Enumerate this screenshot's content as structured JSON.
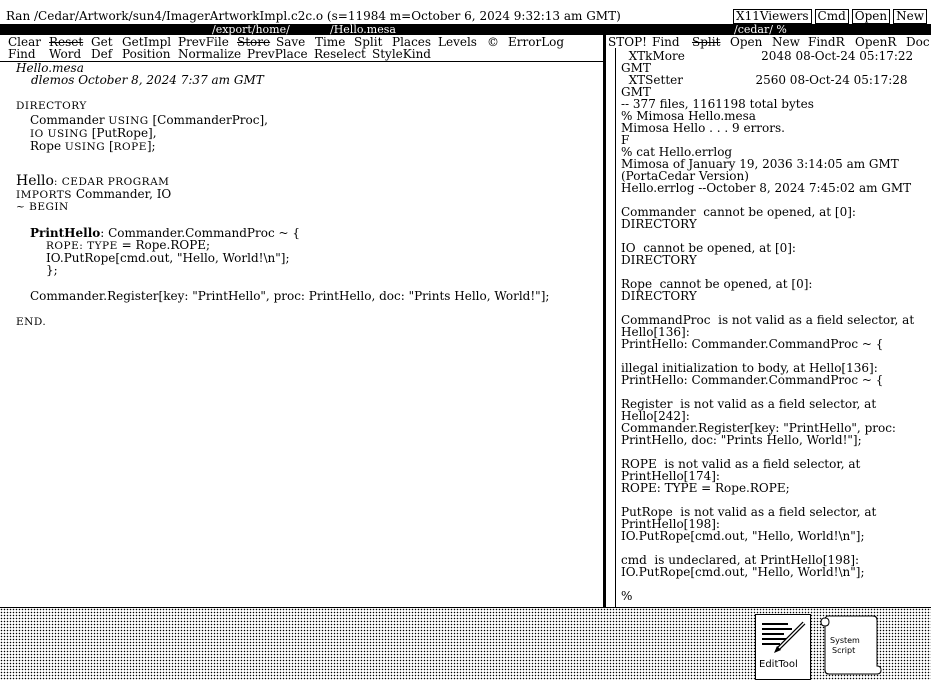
{
  "status": {
    "text": "Ran /Cedar/Artwork/sun4/ImagerArtworkImpl.c2c.o (s=11984 m=October 6, 2024 9:32:13 am GMT)",
    "buttons": [
      "X11Viewers",
      "Cmd",
      "Open",
      "New"
    ]
  },
  "left_viewer": {
    "title_path": "/export/home/",
    "title_file": "/Hello.mesa",
    "menu_row1": [
      "Clear",
      "Reset",
      "Get",
      "GetImpl",
      "PrevFile",
      "Store",
      "Save",
      "Time",
      "Split",
      "Places",
      "Levels",
      "©",
      "ErrorLog"
    ],
    "menu_row2": [
      "Find",
      "Word",
      "Def",
      "Position",
      "Normalize",
      "PrevPlace",
      "Reselect",
      "StyleKind"
    ],
    "doc": {
      "filename": "Hello.mesa",
      "author_line": "dlemos October 8, 2024 7:37 am GMT",
      "directory_kw": "DIRECTORY",
      "dir1_a": "Commander ",
      "dir1_kw": "USING",
      "dir1_b": " [CommanderProc],",
      "dir2_a": "IO",
      "dir2_kw": " USING",
      "dir2_b": " [PutRope],",
      "dir3_a": "Rope ",
      "dir3_kw": "USING",
      "dir3_c": " [",
      "dir3_kw2": "ROPE",
      "dir3_b": "];",
      "hello": "Hello",
      "cedar_program": ": CEDAR PROGRAM",
      "imports_kw": "IMPORTS",
      "imports_rest": " Commander, IO",
      "begin": "~ BEGIN",
      "proc_name": "PrintHello",
      "proc_rest": ": Commander.CommandProc ~ {",
      "rope_kw": "ROPE: TYPE",
      "rope_rest": " = Rope.ROPE;",
      "putrope": "IO.PutRope[cmd.out, \"Hello, World!\\n\"];",
      "close": "};",
      "register": "Commander.Register[key: \"PrintHello\", proc: PrintHello, doc: \"Prints Hello, World!\"];",
      "end": "END."
    }
  },
  "right_viewer": {
    "title": "/cedar/  %",
    "menu": [
      "STOP!",
      "Find",
      "Split",
      "Open",
      "New",
      "FindR",
      "OpenR",
      "Doc"
    ],
    "log": "  XTkMore                    2048 08-Oct-24 05:17:22\nGMT\n  XTSetter                   2560 08-Oct-24 05:17:28\nGMT\n-- 377 files, 1161198 total bytes\n% Mimosa Hello.mesa\nMimosa Hello . . . 9 errors.\nF\n% cat Hello.errlog\nMimosa of January 19, 2036 3:14:05 am GMT\n(PortaCedar Version)\nHello.errlog --October 8, 2024 7:45:02 am GMT\n\nCommander  cannot be opened, at [0]:\nDIRECTORY\n\nIO  cannot be opened, at [0]:\nDIRECTORY\n\nRope  cannot be opened, at [0]:\nDIRECTORY\n\nCommandProc  is not valid as a field selector, at\nHello[136]:\nPrintHello: Commander.CommandProc ~ {\n\nillegal initialization to body, at Hello[136]:\nPrintHello: Commander.CommandProc ~ {\n\nRegister  is not valid as a field selector, at\nHello[242]:\nCommander.Register[key: \"PrintHello\", proc:\nPrintHello, doc: \"Prints Hello, World!\"];\n\nROPE  is not valid as a field selector, at\nPrintHello[174]:\nROPE: TYPE = Rope.ROPE;\n\nPutRope  is not valid as a field selector, at\nPrintHello[198]:\nIO.PutRope[cmd.out, \"Hello, World!\\n\"];\n\ncmd  is undeclared, at PrintHello[198]:\nIO.PutRope[cmd.out, \"Hello, World!\\n\"];\n\n%",
    "prompt": "%"
  },
  "icons": {
    "edittool_label": "EditTool",
    "systemscript_label1": "System",
    "systemscript_label2": "Script"
  }
}
